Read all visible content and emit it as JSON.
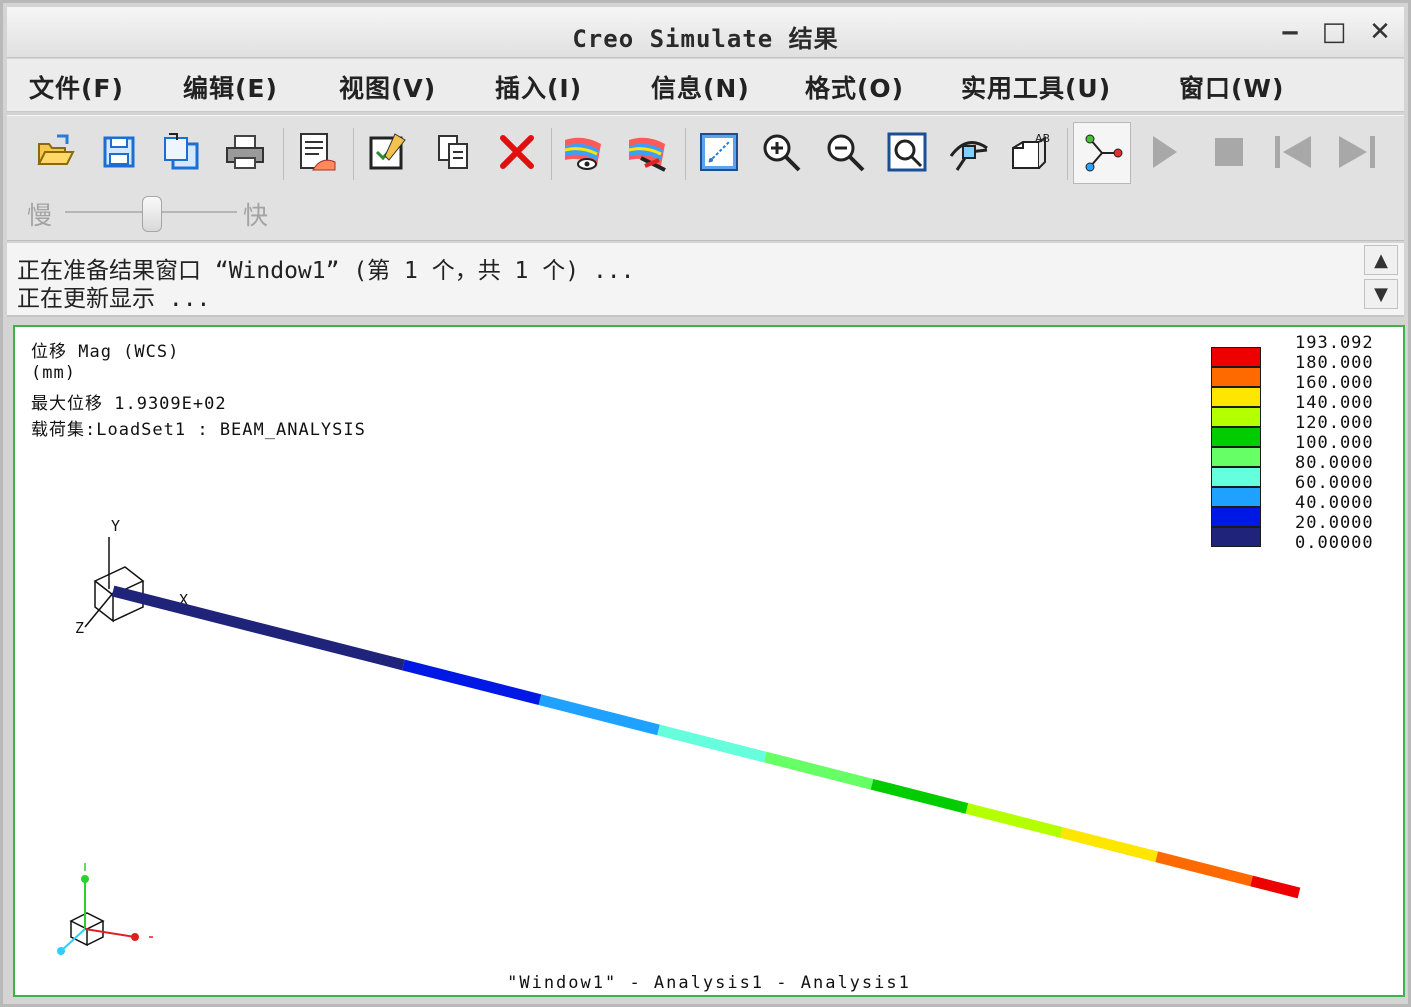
{
  "window": {
    "title": "Creo Simulate 结果",
    "minimize": "‒",
    "maximize": "□",
    "close": "✕"
  },
  "menu": [
    {
      "label": "文件(F)"
    },
    {
      "label": "编辑(E)"
    },
    {
      "label": "视图(V)"
    },
    {
      "label": "插入(I)"
    },
    {
      "label": "信息(N)"
    },
    {
      "label": "格式(O)"
    },
    {
      "label": "实用工具(U)"
    },
    {
      "label": "窗口(W)"
    }
  ],
  "toolbar": {
    "icons": [
      "open-folder-icon",
      "save-icon",
      "save-as-icon",
      "print-icon",
      "report-icon",
      "edit-definition-icon",
      "copy-icon",
      "delete-icon",
      "show-result-icon",
      "hide-result-icon",
      "reorient-icon",
      "zoom-in-icon",
      "zoom-out-icon",
      "zoom-fit-icon",
      "spin-center-icon",
      "named-view-icon",
      "animate-icon",
      "play-icon",
      "stop-icon",
      "first-frame-icon",
      "last-frame-icon"
    ],
    "speed_slow": "慢",
    "speed_fast": "快",
    "speed_level": 0.5
  },
  "messages": {
    "line1": "正在准备结果窗口 “Window1” (第 1 个，共 1 个) ...",
    "line2": "正在更新显示 ..."
  },
  "result": {
    "quantity": "位移 Mag (WCS)",
    "units": "(mm)",
    "max_label": "最大位移 1.9309E+02",
    "loadset": "载荷集:LoadSet1 : BEAM_ANALYSIS",
    "caption": "\"Window1\" - Analysis1 - Analysis1",
    "axis_x": "X",
    "axis_y": "Y",
    "axis_z": "Z"
  },
  "legend": {
    "values": [
      "193.092",
      "180.000",
      "160.000",
      "140.000",
      "120.000",
      "100.000",
      "80.0000",
      "60.0000",
      "40.0000",
      "20.0000",
      "0.00000"
    ],
    "colors": [
      "#ee0000",
      "#ff6a00",
      "#ffe600",
      "#b4ff00",
      "#00cc00",
      "#66ff66",
      "#66ffdd",
      "#1fa2ff",
      "#0018e6",
      "#1f237a"
    ]
  },
  "colors": {
    "viewport_border": "#3ab34a",
    "beam_low": "#1f237a",
    "beam_high": "#ee0000"
  }
}
